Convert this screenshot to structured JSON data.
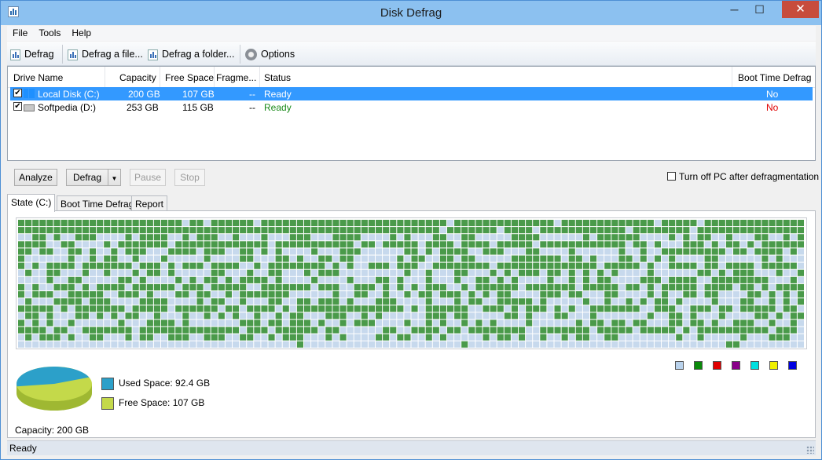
{
  "window": {
    "title": "Disk Defrag",
    "min": "─",
    "max": "☐",
    "close": "✕"
  },
  "menu": [
    "File",
    "Tools",
    "Help"
  ],
  "toolbar": {
    "defrag": "Defrag",
    "defrag_file": "Defrag a file...",
    "defrag_folder": "Defrag a folder...",
    "options": "Options"
  },
  "drives": {
    "columns": [
      "Drive Name",
      "Capacity",
      "Free Space",
      "Fragme...",
      "Status",
      "Boot Time Defrag"
    ],
    "rows": [
      {
        "name": "Local Disk (C:)",
        "capacity": "200 GB",
        "free": "107 GB",
        "frag": "--",
        "status": "Ready",
        "boot": "No",
        "icon": "windows-drive-icon",
        "checked": true
      },
      {
        "name": "Softpedia (D:)",
        "capacity": "253 GB",
        "free": "115 GB",
        "frag": "--",
        "status": "Ready",
        "boot": "No",
        "icon": "hard-drive-icon",
        "checked": true
      }
    ]
  },
  "actions": {
    "analyze": "Analyze",
    "defrag": "Defrag",
    "pause": "Pause",
    "stop": "Stop",
    "turn_off": "Turn off PC after defragmentation"
  },
  "tabs": [
    "State (C:)",
    "Boot Time Defrag",
    "Report"
  ],
  "colors": {
    "used": "#2ca0c9",
    "free": "#c4d94a",
    "block_used": "#4a9a4a",
    "block_free": "#c7d9ed"
  },
  "legend_colors": [
    "#b9d2ec",
    "#0a8a0a",
    "#e00000",
    "#8a008a",
    "#00e0e0",
    "#f0f000",
    "#0000e0"
  ],
  "disk": {
    "used_label": "Used Space: 92.4 GB",
    "free_label": "Free Space: 107 GB",
    "capacity_label": "Capacity: 200 GB",
    "used_fraction": 0.462
  },
  "status": "Ready"
}
